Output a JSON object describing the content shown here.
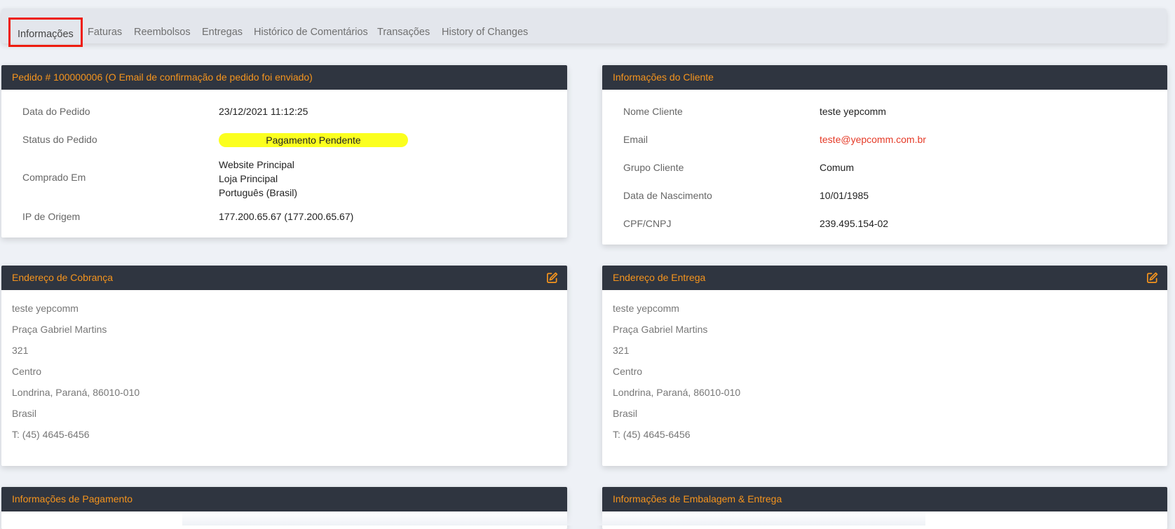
{
  "tabs": [
    {
      "label": "Informações",
      "active": true
    },
    {
      "label": "Faturas"
    },
    {
      "label": "Reembolsos"
    },
    {
      "label": "Entregas"
    },
    {
      "label": "Histórico de Comentários"
    },
    {
      "label": "Transações"
    },
    {
      "label": "History of Changes"
    }
  ],
  "order": {
    "title": "Pedido # 100000006 (O Email de confirmação de pedido foi enviado)",
    "date_label": "Data do Pedido",
    "date_value": "23/12/2021 11:12:25",
    "status_label": "Status do Pedido",
    "status_value": "Pagamento Pendente",
    "status_color": "#fbff1e",
    "purchased_label": "Comprado Em",
    "purchased_lines": [
      "Website Principal",
      "Loja Principal",
      "Português (Brasil)"
    ],
    "ip_label": "IP de Origem",
    "ip_value": "177.200.65.67 (177.200.65.67)"
  },
  "customer": {
    "title": "Informações do Cliente",
    "name_label": "Nome Cliente",
    "name_value": "teste yepcomm",
    "email_label": "Email",
    "email_value": "teste@yepcomm.com.br",
    "group_label": "Grupo Cliente",
    "group_value": "Comum",
    "dob_label": "Data de Nascimento",
    "dob_value": "10/01/1985",
    "doc_label": "CPF/CNPJ",
    "doc_value": "239.495.154-02"
  },
  "billing": {
    "title": "Endereço de Cobrança",
    "icon": "edit-icon",
    "lines": [
      "teste yepcomm",
      "Praça Gabriel Martins",
      "321",
      "Centro",
      "Londrina, Paraná, 86010-010",
      "Brasil",
      "T: (45) 4645-6456"
    ]
  },
  "shipping": {
    "title": "Endereço de Entrega",
    "icon": "edit-icon",
    "lines": [
      "teste yepcomm",
      "Praça Gabriel Martins",
      "321",
      "Centro",
      "Londrina, Paraná, 86010-010",
      "Brasil",
      "T: (45) 4645-6456"
    ]
  },
  "payment": {
    "title": "Informações de Pagamento"
  },
  "packaging": {
    "title": "Informações de Embalagem & Entrega"
  },
  "colors": {
    "header_bg": "#2f3540",
    "header_text": "#f5941d",
    "link": "#e53a27",
    "tab_highlight": "#ee1c0f"
  }
}
